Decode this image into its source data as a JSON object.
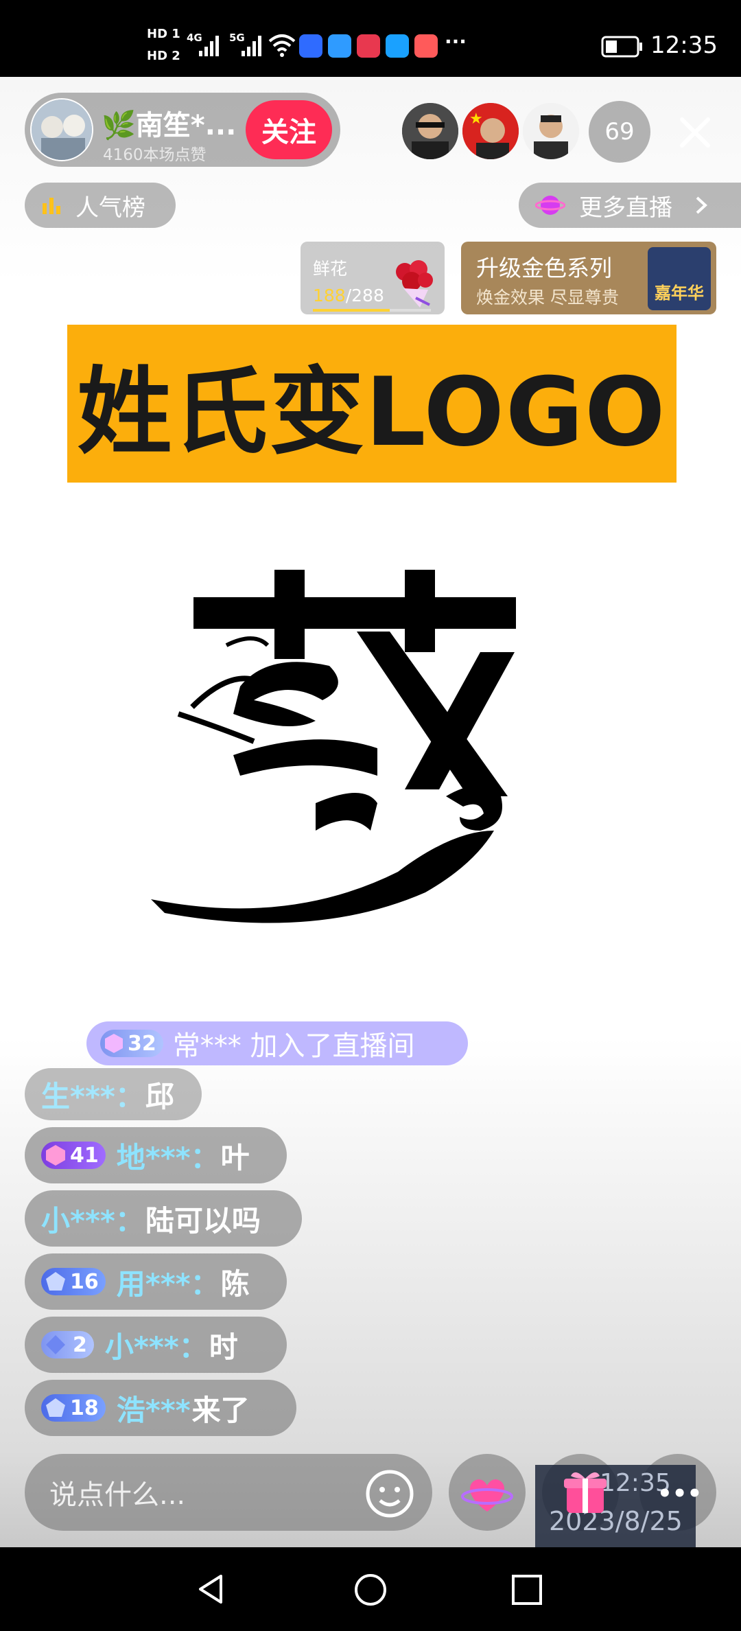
{
  "status_bar": {
    "sim1": "HD 1",
    "sim2": "HD 2",
    "net1": "4G",
    "net2": "5G",
    "more": "···",
    "time": "12:35",
    "app_colors": [
      "#2f6bff",
      "#2f9bff",
      "#e8384f",
      "#1aa1ff",
      "#ff5a5a"
    ]
  },
  "host": {
    "name": "🌿南笙*...",
    "likes": "4160本场点赞",
    "follow_label": "关注"
  },
  "viewers": {
    "count": "69"
  },
  "top_actions": {
    "rank_label": "人气榜",
    "more_live_label": "更多直播"
  },
  "gift_goal": {
    "name": "鲜花",
    "current": "188",
    "total": "/288",
    "progress": 0.65
  },
  "promo": {
    "title": "升级金色系列",
    "subtitle": "焕金效果 尽显尊贵",
    "badge": "嘉年华"
  },
  "stream": {
    "banner_text": "姓氏变LOGO"
  },
  "chat": {
    "join": {
      "level": "32",
      "text": "常*** 加入了直播间"
    },
    "messages": [
      {
        "user": "生***：",
        "text": "邱",
        "level": ""
      },
      {
        "user": "地***：",
        "text": "叶",
        "level": "41"
      },
      {
        "user": "小***：",
        "text": "陆可以吗",
        "level": ""
      },
      {
        "user": "用***：",
        "text": "陈",
        "level": "16"
      },
      {
        "user": "小***：",
        "text": "时",
        "level": "2"
      },
      {
        "user": "浩***",
        "text": " 来了",
        "level": "18"
      }
    ]
  },
  "bottom_bar": {
    "input_placeholder": "说点什么...",
    "overlay_time": "12:35",
    "overlay_date": "2023/8/25",
    "more": "•••"
  }
}
